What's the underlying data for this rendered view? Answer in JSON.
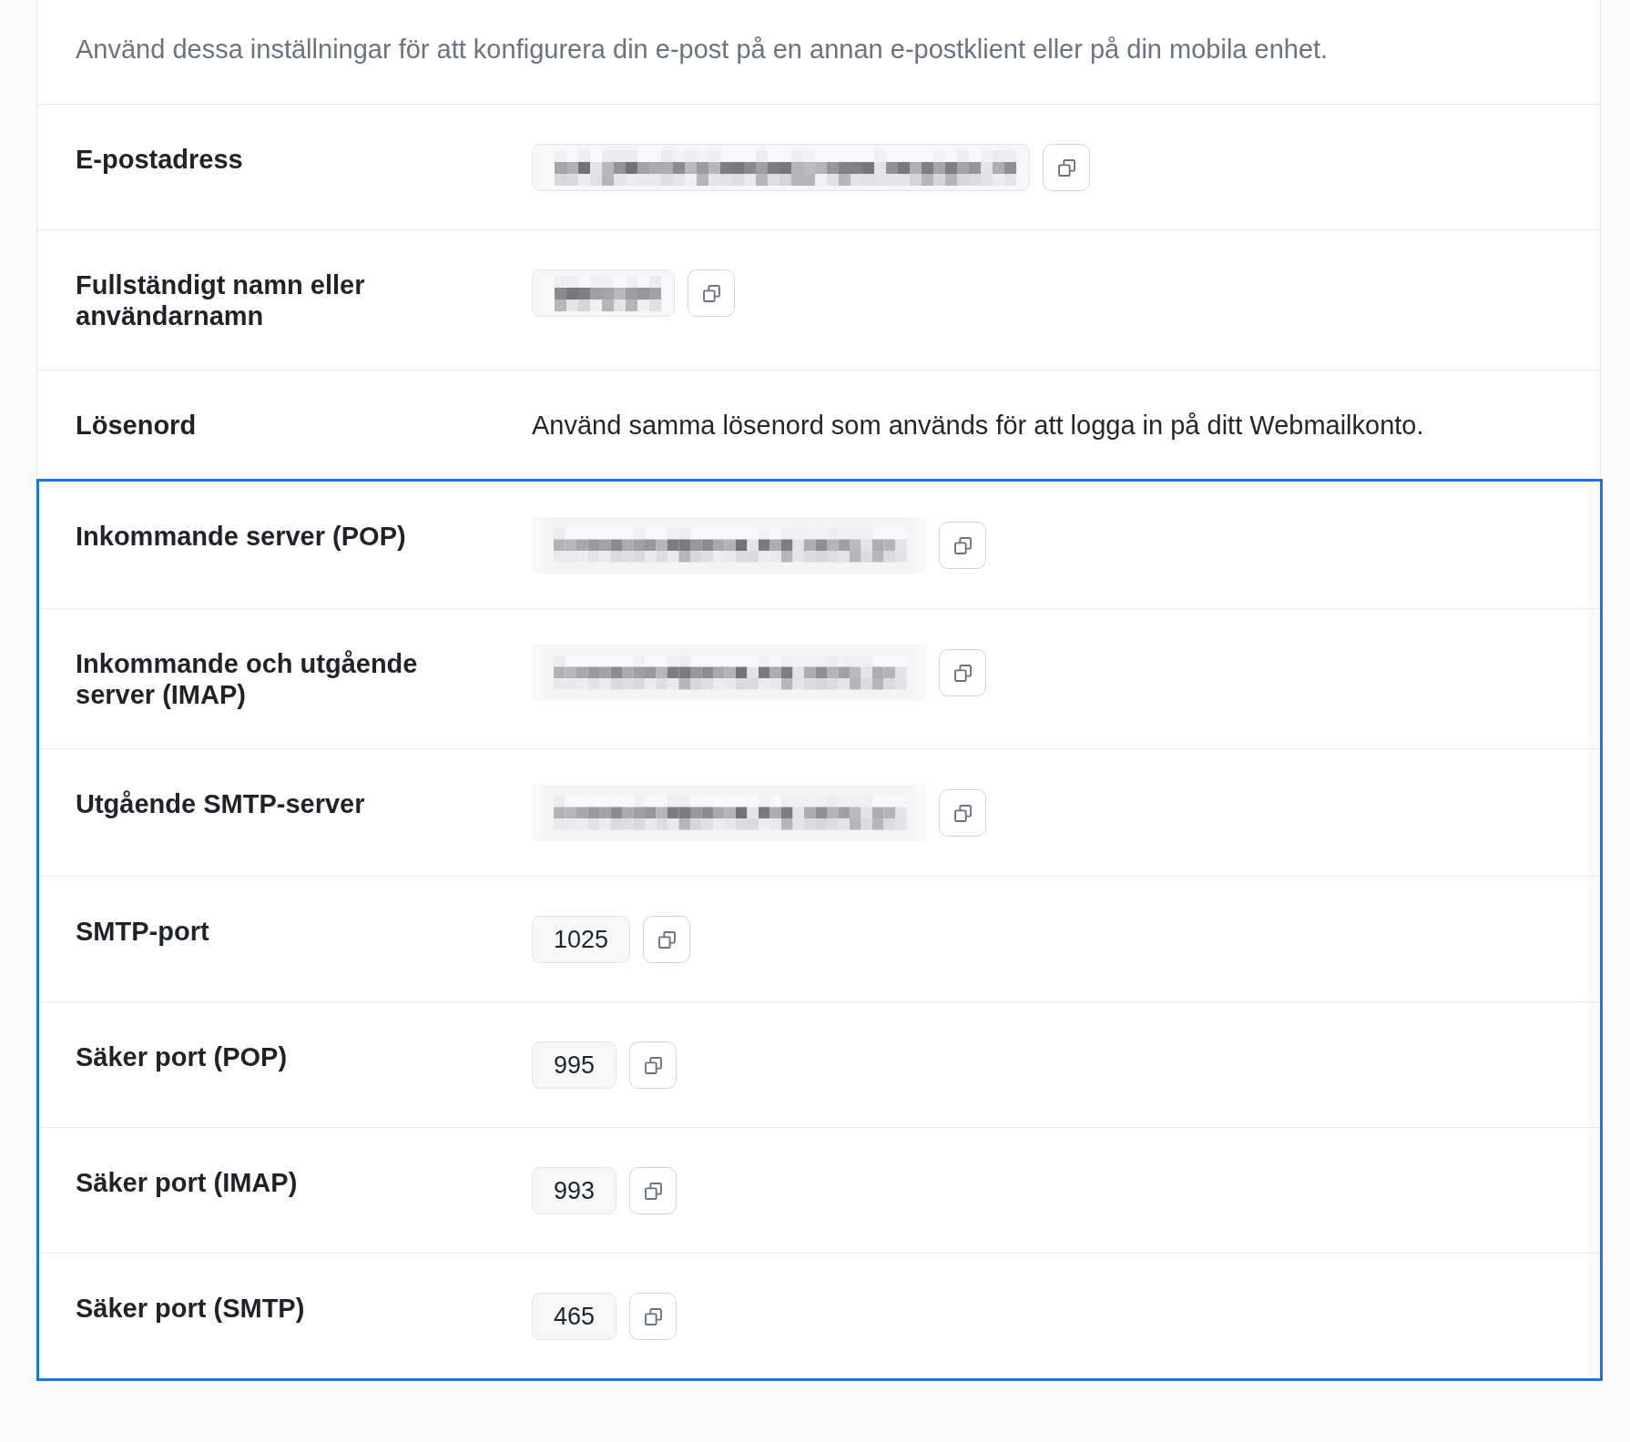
{
  "description": "Använd dessa inställningar för att konfigurera din e-post på en annan e-postklient eller på din mobila enhet.",
  "sections": [
    {
      "highlighted": false,
      "rows": [
        {
          "label": "E-postadress",
          "kind": "masked",
          "copyable": true
        },
        {
          "label": "Fullständigt namn eller användarnamn",
          "kind": "masked",
          "copyable": true
        },
        {
          "label": "Lösenord",
          "kind": "note",
          "value": "Använd samma lösenord som används för att logga in på ditt Webmailkonto.",
          "copyable": false
        }
      ]
    },
    {
      "highlighted": true,
      "rows": [
        {
          "label": "Inkommande server (POP)",
          "kind": "pixelated",
          "copyable": true
        },
        {
          "label": "Inkommande och utgående server (IMAP)",
          "kind": "pixelated",
          "copyable": true
        },
        {
          "label": "Utgående SMTP-server",
          "kind": "pixelated",
          "copyable": true
        },
        {
          "label": "SMTP-port",
          "kind": "field",
          "value": "1025",
          "copyable": true
        },
        {
          "label": "Säker port (POP)",
          "kind": "field",
          "value": "995",
          "copyable": true
        },
        {
          "label": "Säker port (IMAP)",
          "kind": "field",
          "value": "993",
          "copyable": true
        },
        {
          "label": "Säker port (SMTP)",
          "kind": "field",
          "value": "465",
          "copyable": true
        }
      ]
    }
  ]
}
